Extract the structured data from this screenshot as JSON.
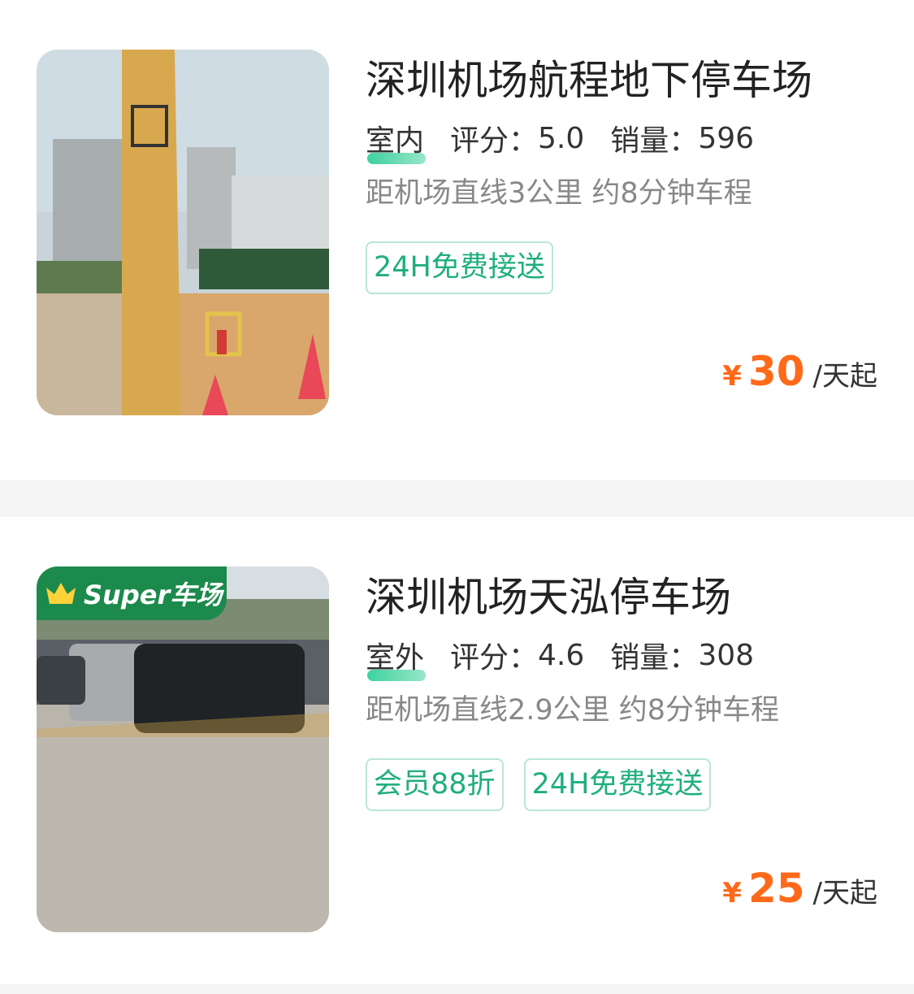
{
  "parkings": [
    {
      "title": "深圳机场航程地下停车场",
      "environment": "室内",
      "rating_label": "评分：",
      "rating": "5.0",
      "sales_label": "销量：",
      "sales": "596",
      "distance": "距机场直线3公里 约8分钟车程",
      "tags": [
        "24H免费接送"
      ],
      "currency": "¥",
      "price": "30",
      "price_unit": "/天起"
    },
    {
      "title": "深圳机场天泓停车场",
      "badge": "Super车场",
      "environment": "室外",
      "rating_label": "评分：",
      "rating": "4.6",
      "sales_label": "销量：",
      "sales": "308",
      "distance": "距机场直线2.9公里 约8分钟车程",
      "tags": [
        "会员88折",
        "24H免费接送"
      ],
      "currency": "¥",
      "price": "25",
      "price_unit": "/天起"
    }
  ],
  "colors": {
    "accent_price": "#ff6a1a",
    "tag_green": "#1fae7f",
    "badge_green": "#1b8a4c"
  },
  "icons": [
    "crown-icon"
  ]
}
